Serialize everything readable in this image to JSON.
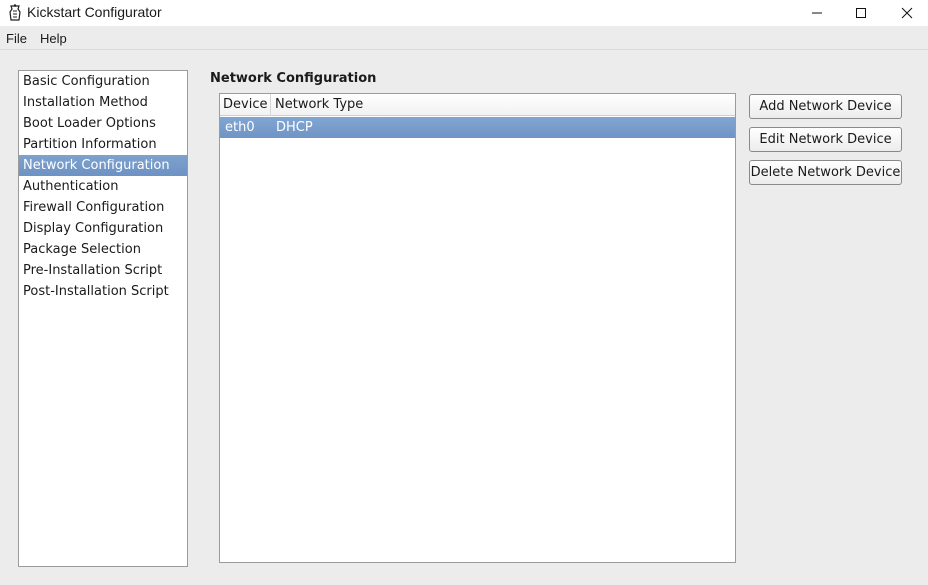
{
  "window": {
    "title": "Kickstart Configurator",
    "controls": {
      "minimize": "—",
      "maximize": "☐",
      "close": "✕"
    }
  },
  "menubar": {
    "items": [
      "File",
      "Help"
    ]
  },
  "nav": {
    "selected_index": 4,
    "items": [
      "Basic Configuration",
      "Installation Method",
      "Boot Loader Options",
      "Partition Information",
      "Network Configuration",
      "Authentication",
      "Firewall Configuration",
      "Display Configuration",
      "Package Selection",
      "Pre-Installation Script",
      "Post-Installation Script"
    ]
  },
  "main": {
    "section_title": "Network Configuration",
    "table": {
      "columns": [
        "Device",
        "Network Type"
      ],
      "rows": [
        {
          "device": "eth0",
          "type": "DHCP",
          "selected": true
        }
      ]
    },
    "buttons": {
      "add": "Add Network Device",
      "edit": "Edit Network Device",
      "delete": "Delete Network Device"
    }
  },
  "colors": {
    "selection": "#7299c9",
    "window_bg": "#ececec"
  }
}
